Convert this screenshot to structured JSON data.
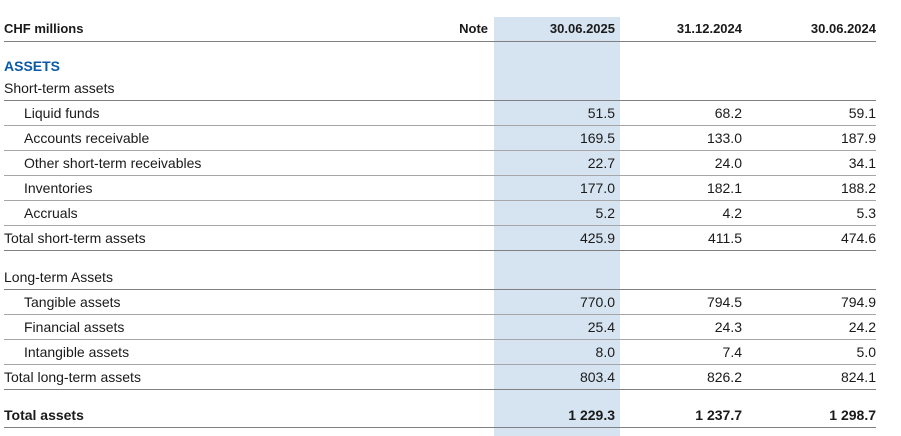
{
  "header": {
    "unit_label": "CHF millions",
    "note_label": "Note",
    "columns": [
      "30.06.2025",
      "31.12.2024",
      "30.06.2024"
    ]
  },
  "section_title": "ASSETS",
  "short_term": {
    "heading": "Short-term assets",
    "rows": [
      {
        "label": "Liquid funds",
        "values": [
          "51.5",
          "68.2",
          "59.1"
        ]
      },
      {
        "label": "Accounts receivable",
        "values": [
          "169.5",
          "133.0",
          "187.9"
        ]
      },
      {
        "label": "Other short-term receivables",
        "values": [
          "22.7",
          "24.0",
          "34.1"
        ]
      },
      {
        "label": "Inventories",
        "values": [
          "177.0",
          "182.1",
          "188.2"
        ]
      },
      {
        "label": "Accruals",
        "values": [
          "5.2",
          "4.2",
          "5.3"
        ]
      }
    ],
    "total": {
      "label": "Total short-term assets",
      "values": [
        "425.9",
        "411.5",
        "474.6"
      ]
    }
  },
  "long_term": {
    "heading": "Long-term Assets",
    "rows": [
      {
        "label": "Tangible assets",
        "values": [
          "770.0",
          "794.5",
          "794.9"
        ]
      },
      {
        "label": "Financial assets",
        "values": [
          "25.4",
          "24.3",
          "24.2"
        ]
      },
      {
        "label": "Intangible assets",
        "values": [
          "8.0",
          "7.4",
          "5.0"
        ]
      }
    ],
    "total": {
      "label": "Total long-term assets",
      "values": [
        "803.4",
        "826.2",
        "824.1"
      ]
    }
  },
  "grand_total": {
    "label": "Total assets",
    "values": [
      "1 229.3",
      "1 237.7",
      "1 298.7"
    ]
  },
  "colors": {
    "highlight": "#d6e4f2",
    "section_title": "#0b5aa8"
  }
}
